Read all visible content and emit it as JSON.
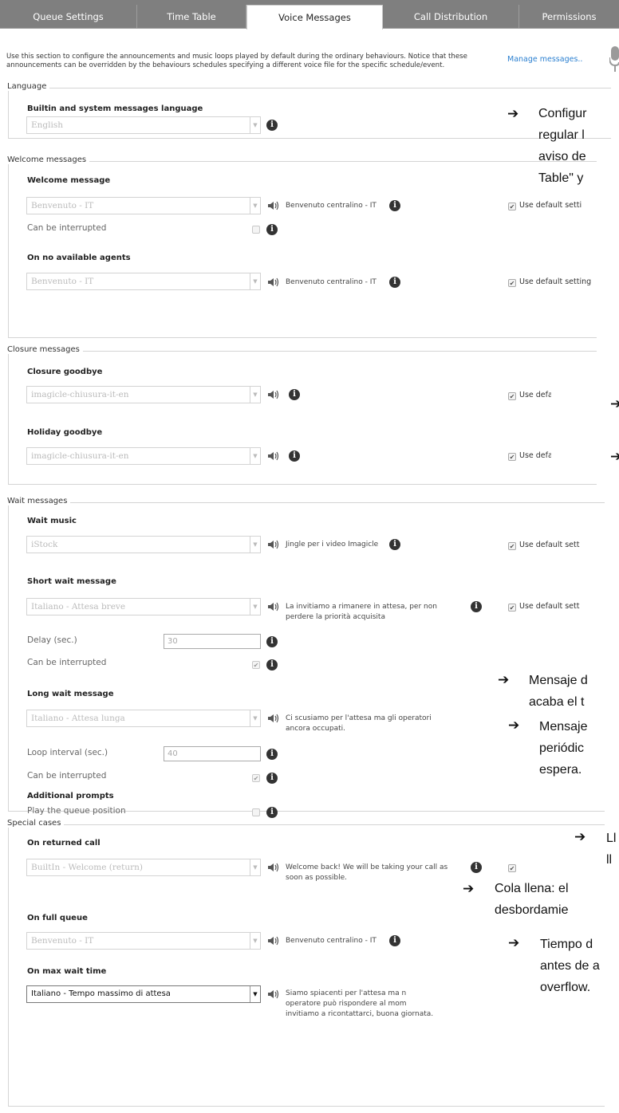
{
  "tabs": [
    "Queue Settings",
    "Time Table",
    "Voice Messages",
    "Call Distribution",
    "Permissions"
  ],
  "intro": "Use this section to configure the announcements and music loops played by default during the ordinary behaviours. Notice that these announcements can be overridden by the behaviours schedules specifying a different voice file for the specific schedule/event.",
  "manage_link": "Manage messages..",
  "icons": {
    "info": "i",
    "speaker": "speaker-icon",
    "mic": "microphone-icon",
    "arrow": "➔",
    "check": "✔",
    "dropdown": "▼"
  },
  "colors": {
    "tab_bar": "#7f7f7f",
    "link": "#2a7fd0",
    "info_icon": "#333333"
  },
  "language": {
    "legend": "Language",
    "label": "Builtin and system messages language",
    "value": "English"
  },
  "welcome": {
    "legend": "Welcome messages",
    "welcome_label": "Welcome message",
    "welcome_value": "Benvenuto - IT",
    "welcome_file": "Benvenuto centralino - IT",
    "welcome_default": "Use default setti",
    "interrupt_label": "Can be interrupted",
    "noagents_label": "On no available agents",
    "noagents_value": "Benvenuto - IT",
    "noagents_file": "Benvenuto centralino - IT",
    "noagents_default": "Use default setting"
  },
  "closure": {
    "legend": "Closure messages",
    "goodbye_label": "Closure goodbye",
    "goodbye_value": "imagicle-chiusura-it-en",
    "goodbye_default": "Use defa",
    "holiday_label": "Holiday goodbye",
    "holiday_value": "imagicle-chiusura-it-en",
    "holiday_default": "Use defa"
  },
  "wait": {
    "legend": "Wait messages",
    "music_label": "Wait music",
    "music_value": "iStock",
    "music_file": "Jingle per i video Imagicle",
    "music_default": "Use default sett",
    "short_label": "Short wait message",
    "short_value": "Italiano - Attesa breve",
    "short_file_1": "La invitiamo a rimanere in attesa, per non",
    "short_file_2": "perdere la priorità acquisita",
    "short_default": "Use default sett",
    "delay_label": "Delay (sec.)",
    "delay_value": "30",
    "interrupt_label": "Can be interrupted",
    "long_label": "Long wait message",
    "long_value": "Italiano - Attesa lunga",
    "long_file_1": "Ci scusiamo per l'attesa ma gli operatori",
    "long_file_2": "ancora occupati.",
    "loop_label": "Loop interval (sec.)",
    "loop_value": "40",
    "interrupt2_label": "Can be interrupted",
    "additional_label": "Additional prompts",
    "position_label": "Play the queue position"
  },
  "special": {
    "legend": "Special cases",
    "returned_label": "On returned call",
    "returned_value": "BuiltIn - Welcome (return)",
    "returned_file_1": "Welcome back! We will be taking your call as",
    "returned_file_2": "soon as possible.",
    "full_label": "On full queue",
    "full_value": "Benvenuto - IT",
    "full_file": "Benvenuto centralino - IT",
    "maxwait_label": "On max wait time",
    "maxwait_value": "Italiano - Tempo massimo di attesa",
    "maxwait_file_1": "Siamo spiacenti per l'attesa ma n",
    "maxwait_file_2": "operatore può rispondere al mom",
    "maxwait_file_3": "invitiamo a ricontattarci, buona giornata."
  },
  "notes": {
    "n1_1": "Configur",
    "n1_2": "regular l",
    "n1_3": "aviso de",
    "n1_4": "Table\" y",
    "n2_1": "Mensaje d",
    "n2_2": "acaba el t",
    "n3_1": "Mensaje",
    "n3_2": "periódic",
    "n3_3": "espera.",
    "n4_1": "Ll",
    "n4_2": "ll",
    "n5_1": "Cola llena: el",
    "n5_2": "desbordamie",
    "n6_1": "Tiempo d",
    "n6_2": "antes de a",
    "n6_3": "overflow."
  }
}
